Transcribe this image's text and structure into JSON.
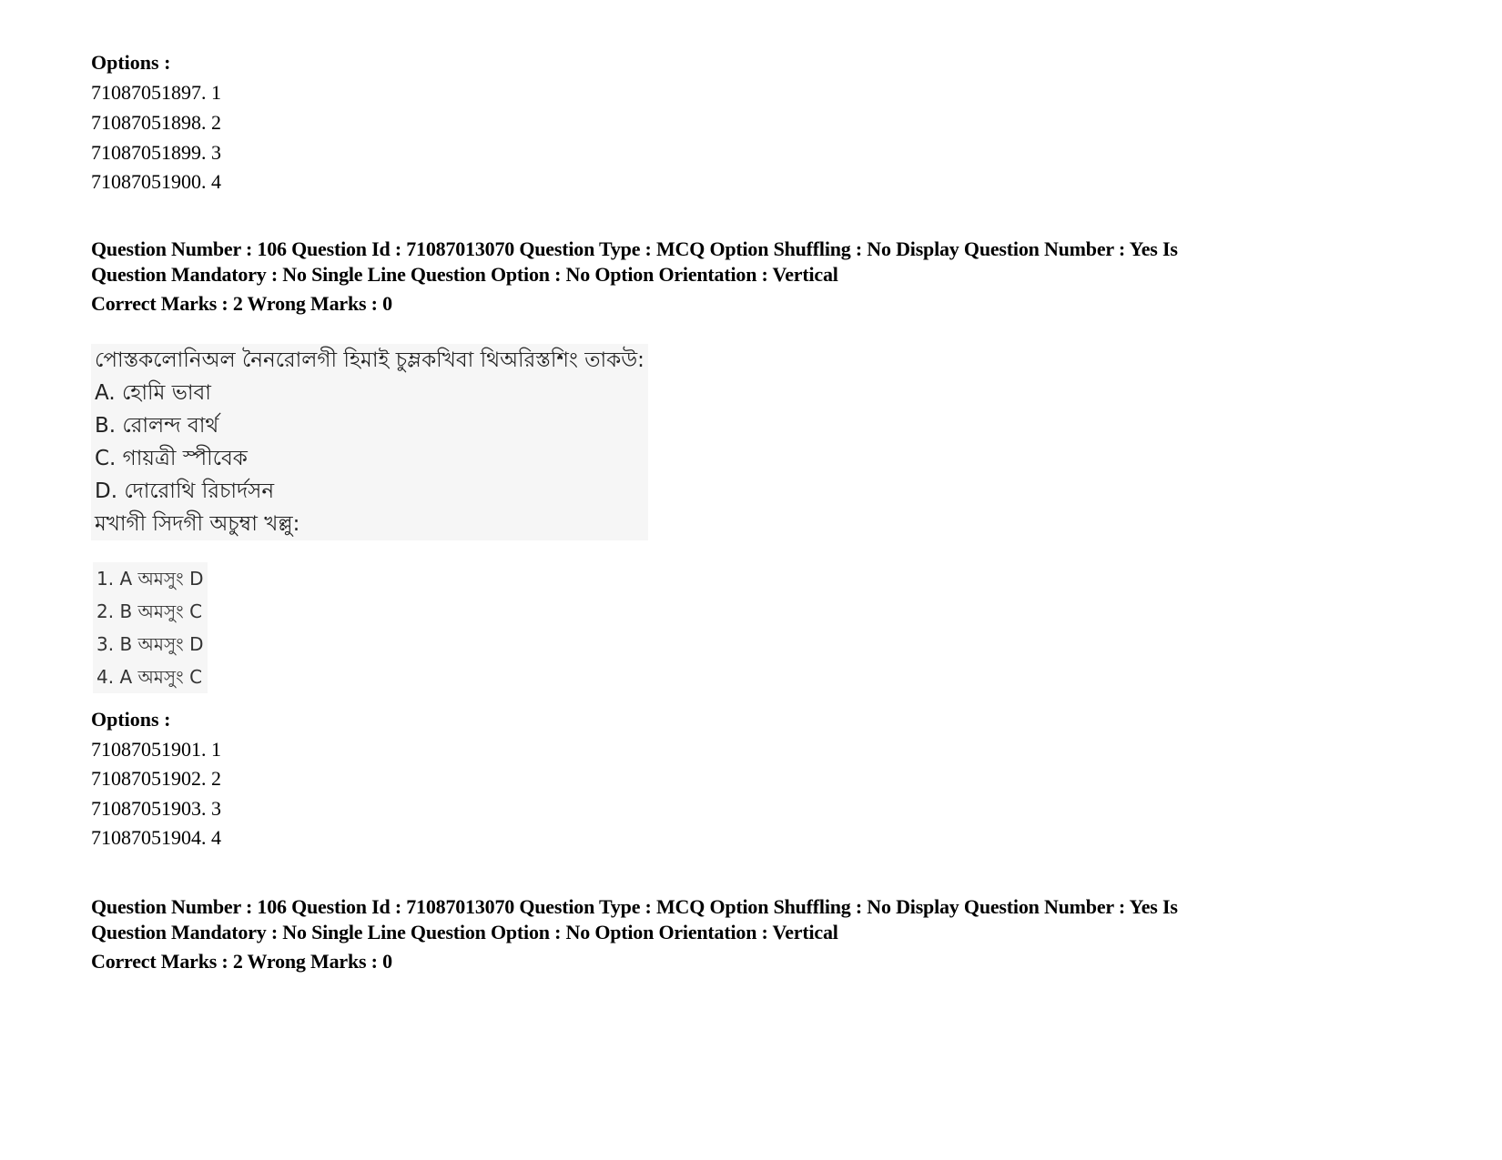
{
  "block1": {
    "options_title": "Options :",
    "options": [
      "71087051897. 1",
      "71087051898. 2",
      "71087051899. 3",
      "71087051900. 4"
    ]
  },
  "question1": {
    "header_line1": "Question Number : 106 Question Id : 71087013070 Question Type : MCQ Option Shuffling : No Display Question Number : Yes Is",
    "header_line2": "Question Mandatory : No Single Line Question Option : No Option Orientation : Vertical",
    "marks": "Correct Marks : 2 Wrong Marks : 0",
    "question_text": "পোস্তকলোনিঅল নৈনরোলগী হিমাই চুম্লকখিবা থিঅরিস্তশিং তাকউ:",
    "items": [
      "A. হোমি ভাবা",
      "B. রোলন্দ বার্থ",
      "C. গায়ত্রী স্পীবেক",
      "D. দোরোথি রিচার্দসন"
    ],
    "instruction": "মখাগী সিদগী অচুম্বা খল্লু:",
    "choices": [
      "1. A অমসুং D",
      "2. B অমসুং C",
      "3. B অমসুং D",
      "4. A অমসুং C"
    ],
    "options_title": "Options :",
    "options": [
      "71087051901. 1",
      "71087051902. 2",
      "71087051903. 3",
      "71087051904. 4"
    ]
  },
  "question2": {
    "header_line1": "Question Number : 106 Question Id : 71087013070 Question Type : MCQ Option Shuffling : No Display Question Number : Yes Is",
    "header_line2": "Question Mandatory : No Single Line Question Option : No Option Orientation : Vertical",
    "marks": "Correct Marks : 2 Wrong Marks : 0"
  }
}
